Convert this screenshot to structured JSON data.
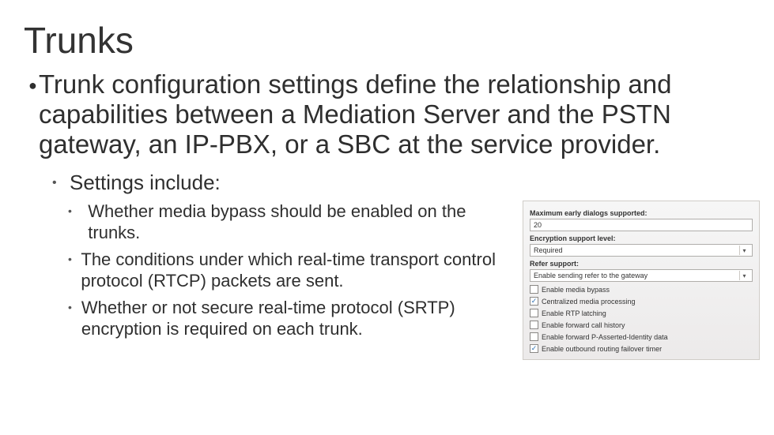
{
  "title": "Trunks",
  "bullet": "Trunk configuration settings define the relationship and capabilities between a Mediation Server and the PSTN gateway, an IP-PBX, or a SBC at the service provider.",
  "settings_label": "Settings include:",
  "sub_bullets": [
    "Whether media bypass should be enabled on the trunks.",
    "The conditions under which real-time transport control protocol (RTCP) packets are sent.",
    "Whether or not secure real-time protocol (SRTP) encryption is required on each trunk."
  ],
  "panel": {
    "max_dialogs_label": "Maximum early dialogs supported:",
    "max_dialogs_value": "20",
    "encryption_label": "Encryption support level:",
    "encryption_value": "Required",
    "refer_label": "Refer support:",
    "refer_value": "Enable sending refer to the gateway",
    "checks": [
      {
        "label": "Enable media bypass",
        "checked": false
      },
      {
        "label": "Centralized media processing",
        "checked": true
      },
      {
        "label": "Enable RTP latching",
        "checked": false
      },
      {
        "label": "Enable forward call history",
        "checked": false
      },
      {
        "label": "Enable forward P-Asserted-Identity data",
        "checked": false
      },
      {
        "label": "Enable outbound routing failover timer",
        "checked": true
      }
    ]
  }
}
